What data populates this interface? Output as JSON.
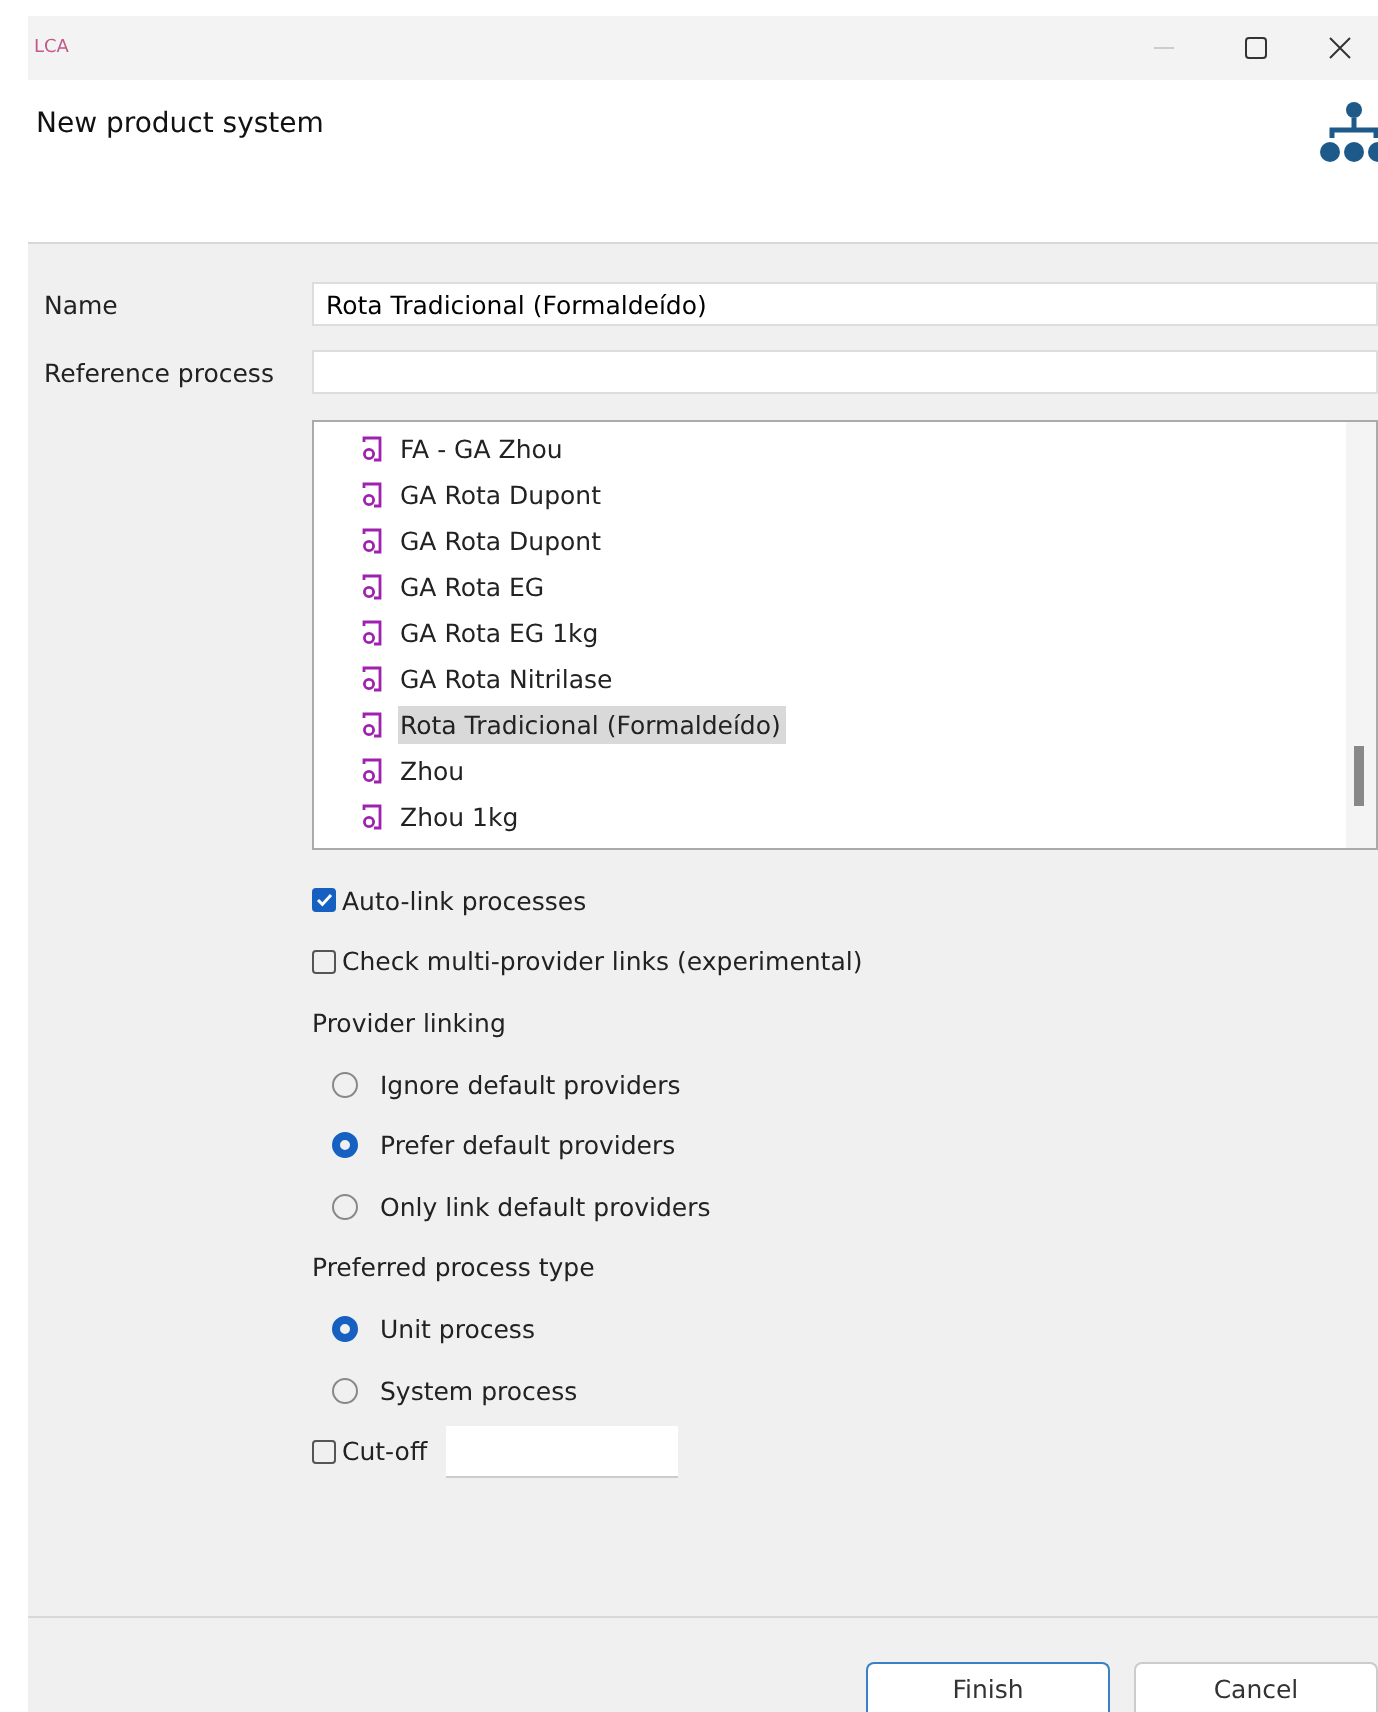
{
  "window": {
    "logo": "LCA"
  },
  "header": {
    "title": "New product system"
  },
  "fields": [
    {
      "label": "Name",
      "value": "Rota Tradicional (Formaldeído)"
    },
    {
      "label": "Reference process"
    }
  ],
  "process_list": [
    {
      "name": "FA - GA Zhou",
      "selected": false
    },
    {
      "name": "GA Rota Dupont",
      "selected": false
    },
    {
      "name": "GA Rota Dupont",
      "selected": false
    },
    {
      "name": "GA Rota EG",
      "selected": false
    },
    {
      "name": "GA Rota EG 1kg",
      "selected": false
    },
    {
      "name": "GA Rota Nitrilase",
      "selected": false
    },
    {
      "name": "Rota Tradicional (Formaldeído)",
      "selected": true
    },
    {
      "name": "Zhou",
      "selected": false
    },
    {
      "name": "Zhou 1kg",
      "selected": false
    }
  ],
  "options": [
    {
      "kind": "checkbox",
      "label": "Auto-link processes",
      "checked": true
    },
    {
      "kind": "checkbox",
      "label": "Check multi-provider links (experimental)",
      "checked": false
    },
    {
      "kind": "heading",
      "label": "Provider linking"
    },
    {
      "kind": "radio",
      "label": "Ignore default providers",
      "selected": false
    },
    {
      "kind": "radio",
      "label": "Prefer default providers",
      "selected": true
    },
    {
      "kind": "radio",
      "label": "Only link default providers",
      "selected": false
    },
    {
      "kind": "heading",
      "label": "Preferred process type"
    },
    {
      "kind": "radio",
      "label": "Unit process",
      "selected": true
    },
    {
      "kind": "radio",
      "label": "System process",
      "selected": false
    },
    {
      "kind": "cutoff",
      "label": "Cut-off",
      "checked": false
    }
  ],
  "buttons": [
    {
      "label": "Finish",
      "default": true
    },
    {
      "label": "Cancel",
      "default": false
    }
  ]
}
